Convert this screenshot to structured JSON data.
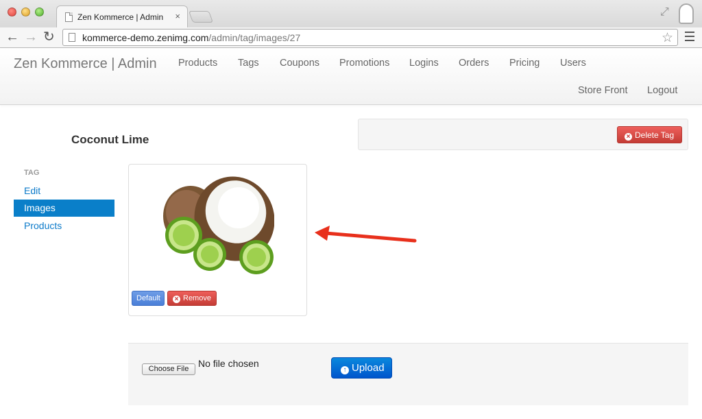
{
  "browser": {
    "tab_title": "Zen Kommerce | Admin",
    "tab_close": "×",
    "url_host": "kommerce-demo.zenimg.com",
    "url_path": "/admin/tag/images/27",
    "back_glyph": "←",
    "forward_glyph": "→",
    "reload_glyph": "↻",
    "star_glyph": "☆",
    "fullscreen_glyph": "⤢"
  },
  "navbar": {
    "brand": "Zen Kommerce | Admin",
    "links": [
      "Products",
      "Tags",
      "Coupons",
      "Promotions",
      "Logins",
      "Orders",
      "Pricing",
      "Users"
    ],
    "right_links": [
      "Store Front",
      "Logout"
    ]
  },
  "page": {
    "title": "Coconut Lime",
    "delete_label": "Delete Tag",
    "icon_x": "×"
  },
  "sidebar": {
    "header": "TAG",
    "items": [
      {
        "label": "Edit",
        "active": false
      },
      {
        "label": "Images",
        "active": true
      },
      {
        "label": "Products",
        "active": false
      }
    ]
  },
  "image_card": {
    "image_subject": "coconut-lime-photo",
    "default_label": "Default",
    "remove_label": "Remove"
  },
  "upload": {
    "choose_label": "Choose File",
    "no_file_text": "No file chosen",
    "upload_label": "Upload",
    "icon_up": "↑"
  },
  "colors": {
    "primary": "#0a7fc9",
    "danger": "#d9433e",
    "annotation_arrow": "#e8301c"
  }
}
